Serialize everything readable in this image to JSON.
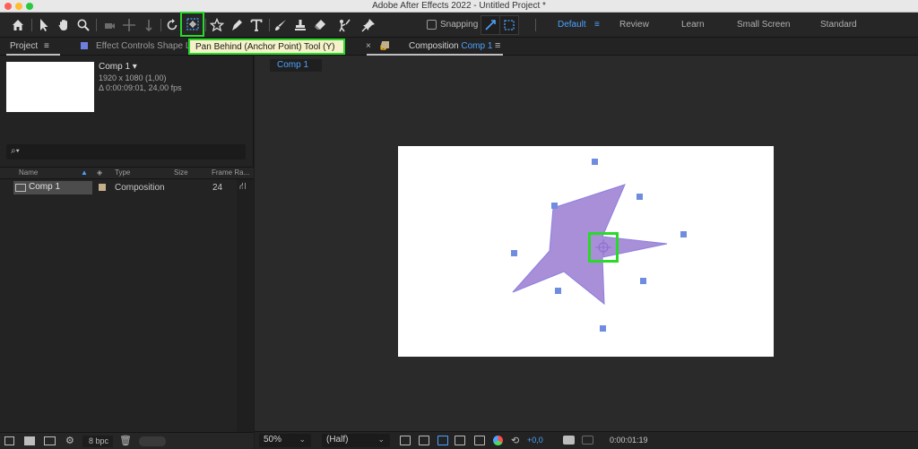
{
  "app": {
    "title": "Adobe After Effects 2022 - Untitled Project *"
  },
  "toolbar": {
    "snapping_label": "Snapping",
    "tooltip": "Pan Behind (Anchor Point) Tool (Y)",
    "workspaces": [
      {
        "label": "Default",
        "active": true
      },
      {
        "label": "Review",
        "active": false
      },
      {
        "label": "Learn",
        "active": false
      },
      {
        "label": "Small Screen",
        "active": false
      },
      {
        "label": "Standard",
        "active": false
      }
    ]
  },
  "project_panel": {
    "tab_label": "Project",
    "effect_controls_label": "Effect Controls Shape La",
    "comp_name": "Comp 1",
    "comp_dims": "1920 x 1080 (1,00)",
    "comp_duration": "Δ 0:00:09:01, 24,00 fps",
    "search_placeholder": "",
    "columns": {
      "name": "Name",
      "type": "Type",
      "size": "Size",
      "frame_rate": "Frame Ra..."
    },
    "items": [
      {
        "name": "Comp 1",
        "type": "Composition",
        "size": "",
        "frame_rate": "24"
      }
    ],
    "bpc": "8 bpc"
  },
  "composition_panel": {
    "tab_prefix": "Composition",
    "tab_comp": "Comp 1",
    "breadcrumb": "Comp 1",
    "zoom": "50%",
    "resolution": "(Half)",
    "exposure": "+0,0",
    "timecode": "0:00:01:19"
  },
  "colors": {
    "accent": "#4da2ff",
    "highlight": "#2bd92b",
    "star_fill": "#a88fd8",
    "handle": "#6f8ce0"
  }
}
